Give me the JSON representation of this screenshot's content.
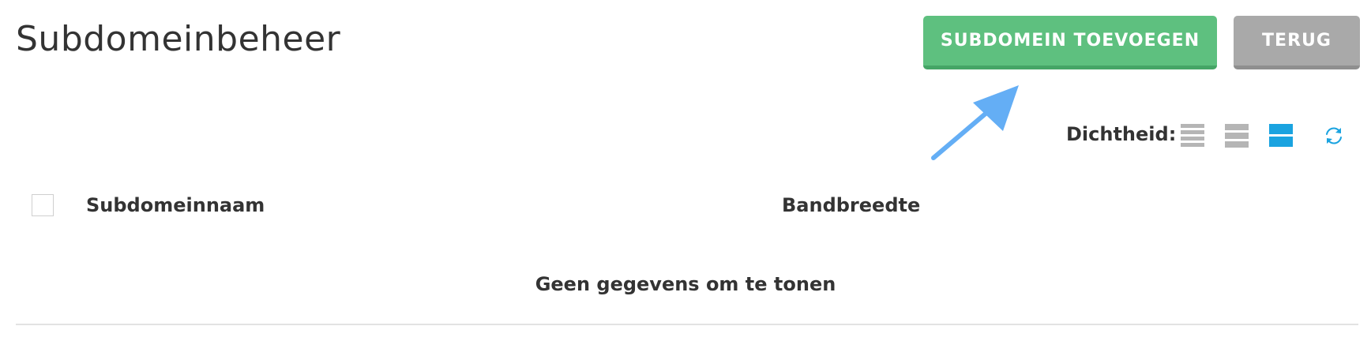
{
  "header": {
    "title": "Subdomeinbeheer",
    "add_button_label": "SUBDOMEIN TOEVOEGEN",
    "back_button_label": "TERUG"
  },
  "toolbar": {
    "density_label": "Dichtheid:",
    "density_options": [
      "compact",
      "normal",
      "comfortable"
    ],
    "density_selected": "comfortable",
    "icons": [
      "density-compact-icon",
      "density-normal-icon",
      "density-comfortable-icon",
      "refresh-icon"
    ]
  },
  "table": {
    "columns": [
      "Subdomeinnaam",
      "Bandbreedte"
    ],
    "rows": [],
    "empty_message": "Geen gegevens om te tonen"
  },
  "colors": {
    "primary_button": "#5ec07f",
    "secondary_button": "#a9a9a9",
    "accent_blue": "#1aa3e0",
    "annotation_arrow": "#64aef5",
    "inactive_icon": "#b5b5b5"
  }
}
